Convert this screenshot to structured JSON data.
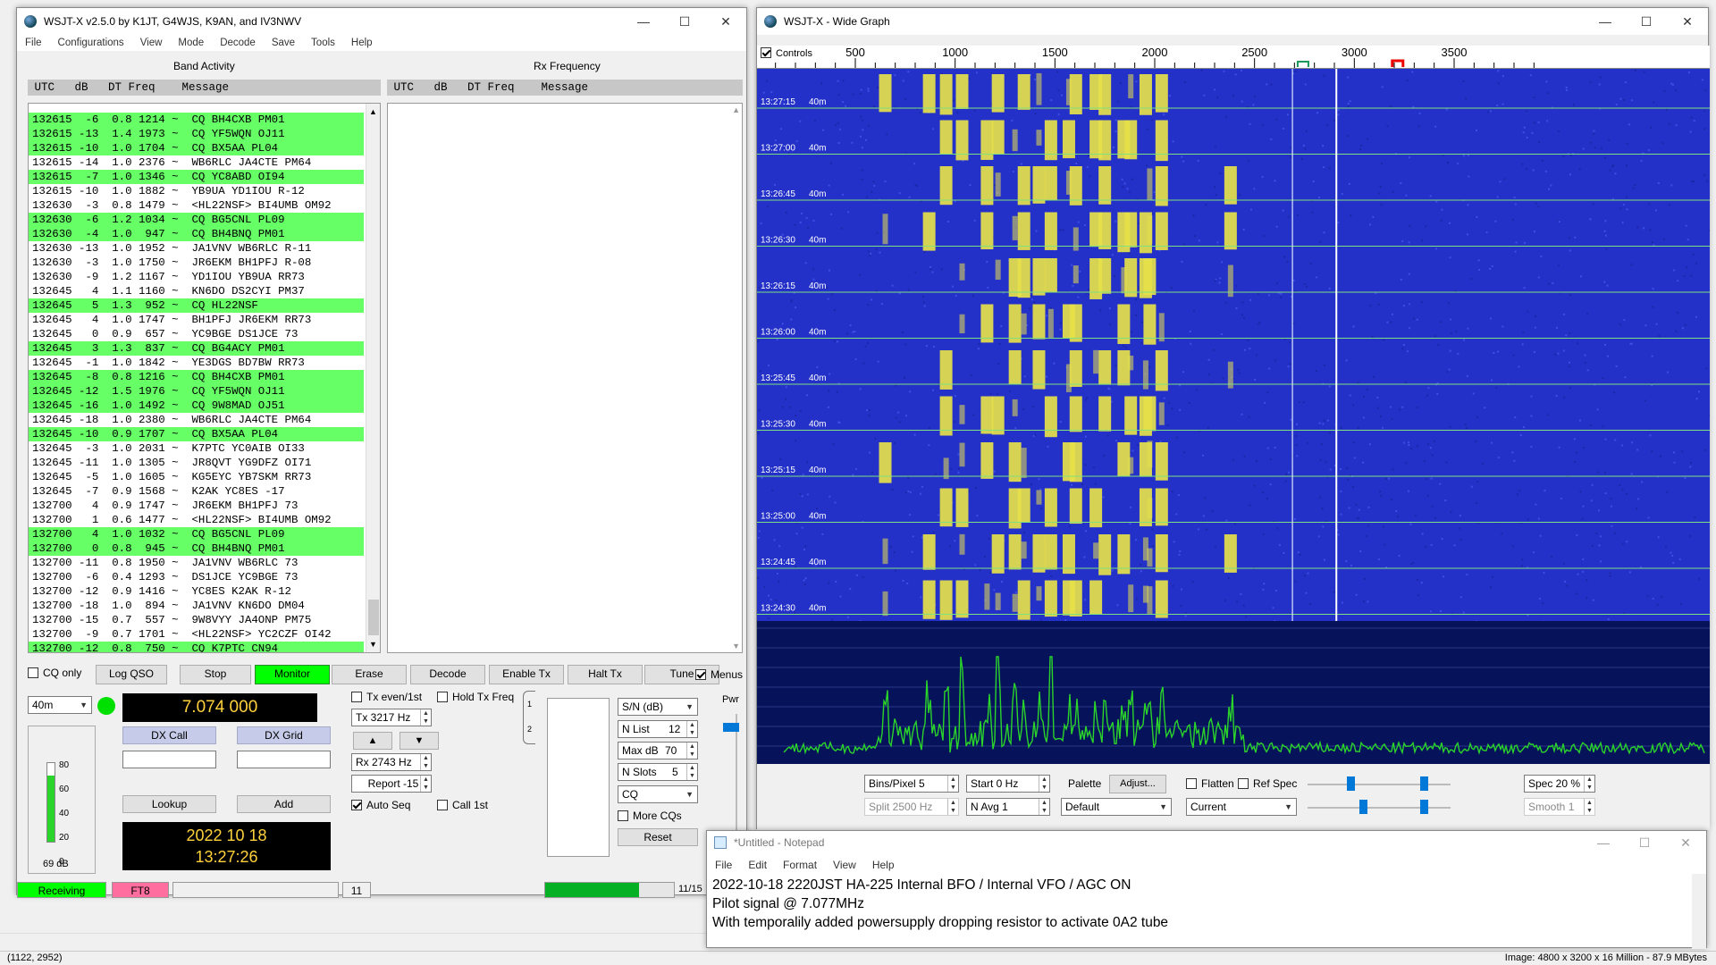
{
  "viewer": {
    "coord": "(1122, 2952)",
    "info": "Image:  4800 x 3200 x 16 Million - 87.9 MBytes"
  },
  "wsjt": {
    "title": "WSJT-X   v2.5.0   by K1JT, G4WJS, K9AN, and IV3NWV",
    "menu": [
      "File",
      "Configurations",
      "View",
      "Mode",
      "Decode",
      "Save",
      "Tools",
      "Help"
    ],
    "band_activity_label": "Band Activity",
    "rx_frequency_label": "Rx Frequency",
    "band_header": " UTC   dB   DT Freq    Message",
    "rx_header": " UTC   dB   DT Freq    Message",
    "rows": [
      {
        "text": "132615  -6  0.8 1214 ~  CQ BH4CXB PM01",
        "cq": true
      },
      {
        "text": "132615 -13  1.4 1973 ~  CQ YF5WQN OJ11",
        "cq": true
      },
      {
        "text": "132615 -10  1.0 1704 ~  CQ BX5AA PL04",
        "cq": true
      },
      {
        "text": "132615 -14  1.0 2376 ~  WB6RLC JA4CTE PM64",
        "cq": false
      },
      {
        "text": "132615  -7  1.0 1346 ~  CQ YC8ABD OI94",
        "cq": true
      },
      {
        "text": "132615 -10  1.0 1882 ~  YB9UA YD1IOU R-12",
        "cq": false
      },
      {
        "text": "132630  -3  0.8 1479 ~  <HL22NSF> BI4UMB OM92",
        "cq": false
      },
      {
        "text": "132630  -6  1.2 1034 ~  CQ BG5CNL PL09",
        "cq": true
      },
      {
        "text": "132630  -4  1.0  947 ~  CQ BH4BNQ PM01",
        "cq": true
      },
      {
        "text": "132630 -13  1.0 1952 ~  JA1VNV WB6RLC R-11",
        "cq": false
      },
      {
        "text": "132630  -3  1.0 1750 ~  JR6EKM BH1PFJ R-08",
        "cq": false
      },
      {
        "text": "132630  -9  1.2 1167 ~  YD1IOU YB9UA RR73",
        "cq": false
      },
      {
        "text": "132645   4  1.1 1160 ~  KN6DO DS2CYI PM37",
        "cq": false
      },
      {
        "text": "132645   5  1.3  952 ~  CQ HL22NSF",
        "cq": true
      },
      {
        "text": "132645   4  1.0 1747 ~  BH1PFJ JR6EKM RR73",
        "cq": false
      },
      {
        "text": "132645   0  0.9  657 ~  YC9BGE DS1JCE 73",
        "cq": false
      },
      {
        "text": "132645   3  1.3  837 ~  CQ BG4ACY PM01",
        "cq": true
      },
      {
        "text": "132645  -1  1.0 1842 ~  YE3DGS BD7BW RR73",
        "cq": false
      },
      {
        "text": "132645  -8  0.8 1216 ~  CQ BH4CXB PM01",
        "cq": true
      },
      {
        "text": "132645 -12  1.5 1976 ~  CQ YF5WQN OJ11",
        "cq": true
      },
      {
        "text": "132645 -16  1.0 1492 ~  CQ 9W8MAD OJ51",
        "cq": true
      },
      {
        "text": "132645 -18  1.0 2380 ~  WB6RLC JA4CTE PM64",
        "cq": false
      },
      {
        "text": "132645 -10  0.9 1707 ~  CQ BX5AA PL04",
        "cq": true
      },
      {
        "text": "132645  -3  1.0 2031 ~  K7PTC YC0AIB OI33",
        "cq": false
      },
      {
        "text": "132645 -11  1.0 1305 ~  JR8QVT YG9DFZ OI71",
        "cq": false
      },
      {
        "text": "132645  -5  1.0 1605 ~  KG5EYC YB7SKM RR73",
        "cq": false
      },
      {
        "text": "132645  -7  0.9 1568 ~  K2AK YC8ES -17",
        "cq": false
      },
      {
        "text": "132700   4  0.9 1747 ~  JR6EKM BH1PFJ 73",
        "cq": false
      },
      {
        "text": "132700   1  0.6 1477 ~  <HL22NSF> BI4UMB OM92",
        "cq": false
      },
      {
        "text": "132700   4  1.0 1032 ~  CQ BG5CNL PL09",
        "cq": true
      },
      {
        "text": "132700   0  0.8  945 ~  CQ BH4BNQ PM01",
        "cq": true
      },
      {
        "text": "132700 -11  0.8 1950 ~  JA1VNV WB6RLC 73",
        "cq": false
      },
      {
        "text": "132700  -6  0.4 1293 ~  DS1JCE YC9BGE 73",
        "cq": false
      },
      {
        "text": "132700 -12  0.9 1416 ~  YC8ES K2AK R-12",
        "cq": false
      },
      {
        "text": "132700 -18  1.0  894 ~  JA1VNV KN6DO DM04",
        "cq": false
      },
      {
        "text": "132700 -15  0.7  557 ~  9W8VYY JA4ONP PM75",
        "cq": false
      },
      {
        "text": "132700  -9  0.7 1701 ~  <HL22NSF> YC2CZF OI42",
        "cq": false
      },
      {
        "text": "132700 -12  0.8  750 ~  CQ K7PTC CN94",
        "cq": true
      }
    ],
    "buttons": {
      "cq_only": "CQ only",
      "log_qso": "Log QSO",
      "stop": "Stop",
      "monitor": "Monitor",
      "erase": "Erase",
      "decode": "Decode",
      "enable_tx": "Enable Tx",
      "halt_tx": "Halt Tx",
      "tune": "Tune",
      "menus": "Menus",
      "dx_call": "DX Call",
      "dx_grid": "DX Grid",
      "lookup": "Lookup",
      "add": "Add",
      "reset": "Reset"
    },
    "band": "40m",
    "frequency": "7.074 000",
    "tx_even": "Tx even/1st",
    "hold_tx": "Hold Tx Freq",
    "tx_freq": "Tx  3217  Hz",
    "rx_freq": "Rx  2743  Hz",
    "report": "Report  -15",
    "auto_seq": "Auto Seq",
    "call_1st": "Call 1st",
    "date": "2022 10 18",
    "time": "13:27:26",
    "level_db": "69 dB",
    "meter_ticks": [
      "80",
      "60",
      "40",
      "20",
      "0"
    ],
    "sn_combo": "S/N (dB)",
    "n_list": "N List",
    "n_list_val": "12",
    "max_db": "Max dB",
    "max_db_val": "70",
    "n_slots": "N Slots",
    "n_slots_val": "5",
    "cq_combo": "CQ",
    "more_cqs": "More CQs",
    "pwr": "Pwr",
    "status": {
      "receiving": "Receiving",
      "mode": "FT8",
      "count": "11",
      "progress": "11/15",
      "progress_frac": 0.73
    }
  },
  "wg": {
    "title": "WSJT-X - Wide Graph",
    "controls": "Controls",
    "scale": [
      "500",
      "1000",
      "1500",
      "2000",
      "2500",
      "3000",
      "3500"
    ],
    "times": [
      "13:27:15",
      "13:27:00",
      "13:26:45",
      "13:26:30",
      "13:26:15",
      "13:26:00",
      "13:25:45",
      "13:25:30",
      "13:25:15",
      "13:25:00",
      "13:24:45",
      "13:24:30"
    ],
    "band": "40m",
    "bins_pixel": "Bins/Pixel  5",
    "start": "Start  0 Hz",
    "palette": "Palette",
    "adjust": "Adjust...",
    "flatten": "Flatten",
    "ref_spec": "Ref Spec",
    "spec": "Spec  20 %",
    "split": "Split   2500   Hz",
    "n_avg": "N Avg  1",
    "palette_val": "Default",
    "current": "Current",
    "smooth": "Smooth    1",
    "colors": {
      "waterfall": "#2431c8",
      "signal": "#e6e04a",
      "spectrum": "#2ad42a"
    }
  },
  "np": {
    "title": "*Untitled - Notepad",
    "menu": [
      "File",
      "Edit",
      "Format",
      "View",
      "Help"
    ],
    "lines": [
      "2022-10-18 2220JST HA-225 Internal BFO / Internal VFO / AGC ON",
      "Pilot signal @ 7.077MHz",
      "With temporalily added powersupply dropping resistor to activate 0A2 tube"
    ]
  }
}
